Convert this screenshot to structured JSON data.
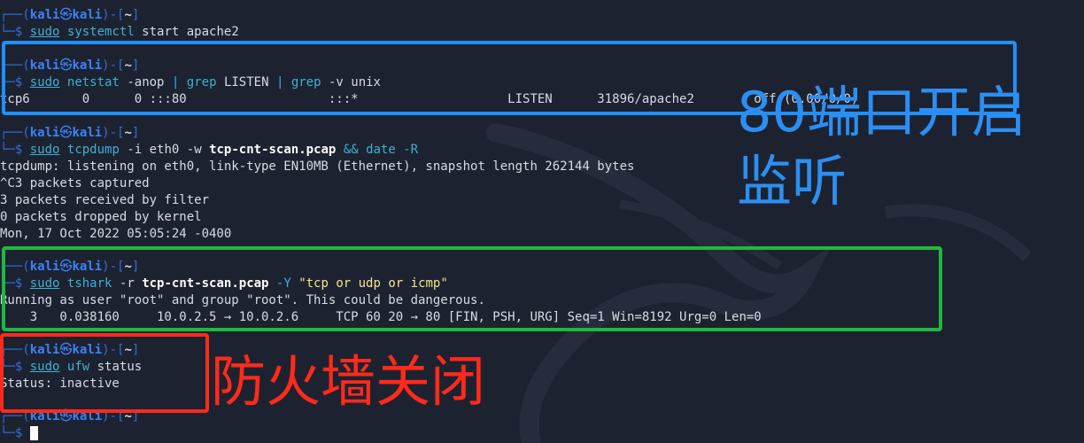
{
  "prompt": {
    "user": "kali",
    "at": "㉿",
    "host": "kali",
    "dir": "~",
    "frame_top": "┌──",
    "frame_bottom": "└─",
    "dollar": "$"
  },
  "blocks": [
    {
      "sudo": "sudo",
      "cmd": "systemctl",
      "args": " start apache2"
    },
    {
      "sudo": "sudo",
      "cmd": "netstat",
      "args": " -anop ",
      "pipe1": "|",
      "grep1": " grep",
      "mid": " LISTEN ",
      "pipe2": "|",
      "grep2": " grep",
      "end": " -v unix",
      "output": "tcp6       0      0 :::80                   :::*                    LISTEN      31896/apache2        off (0.00/0/0)"
    },
    {
      "sudo": "sudo",
      "cmd": "tcpdump",
      "args": " -i eth0 -w ",
      "file": "tcp-cnt-scan.pcap",
      "amp": " && ",
      "date": "date",
      "dflag": " -R",
      "output": [
        "tcpdump: listening on eth0, link-type EN10MB (Ethernet), snapshot length 262144 bytes",
        "^C3 packets captured",
        "3 packets received by filter",
        "0 packets dropped by kernel",
        "Mon, 17 Oct 2022 05:05:24 -0400"
      ]
    },
    {
      "sudo": "sudo",
      "cmd": "tshark",
      "args": " -r ",
      "file": "tcp-cnt-scan.pcap",
      "flag": " -Y ",
      "filter": "\"tcp or udp or icmp\"",
      "output": [
        "Running as user \"root\" and group \"root\". This could be dangerous.",
        "    3   0.038160     10.0.2.5 → 10.0.2.6     TCP 60 20 → 80 [FIN, PSH, URG] Seq=1 Win=8192 Urg=0 Len=0"
      ]
    },
    {
      "sudo": "sudo",
      "cmd": "ufw",
      "args": " status",
      "output": "Status: inactive"
    }
  ],
  "annotations": {
    "blue": [
      "80端口开启",
      "监听"
    ],
    "red": "防火墙关闭"
  },
  "colors": {
    "blue_box": "#1e90ff",
    "green_box": "#1fb83d",
    "red_box": "#ff2a1a",
    "background": "#1d2231"
  }
}
